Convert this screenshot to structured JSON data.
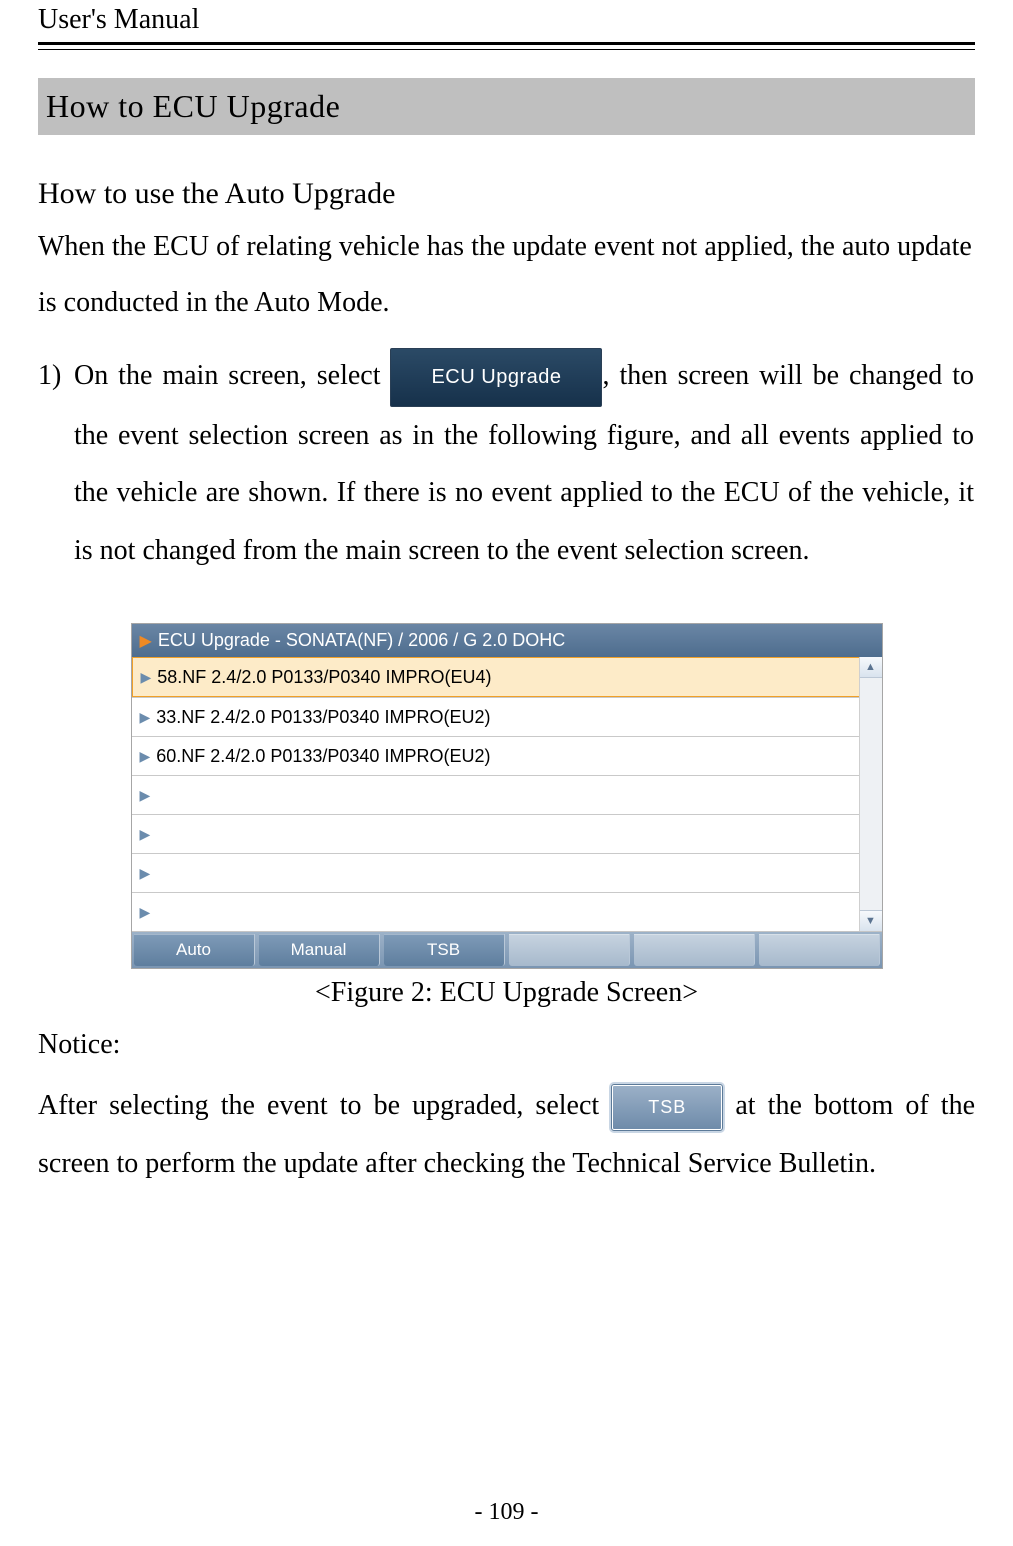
{
  "header": {
    "manual_title": "User's Manual"
  },
  "section": {
    "title": "How to ECU Upgrade",
    "subtitle": "How to use the Auto Upgrade",
    "intro": "When the ECU of relating vehicle has the update event not applied, the auto update is conducted in the Auto Mode.",
    "step_num": "1)",
    "step_a": "On the main screen, select ",
    "ecu_btn_label": "ECU Upgrade",
    "step_b": ", then screen will be changed to the event selection screen as in the following figure, and all events applied to the vehicle are shown. If there is no event applied to the ECU of the vehicle, it is not changed from the main screen to the event selection screen."
  },
  "screenshot": {
    "title_prefix": "▶",
    "title": "ECU Upgrade - SONATA(NF) / 2006 / G 2.0 DOHC",
    "rows": [
      {
        "label": "58.NF 2.4/2.0 P0133/P0340 IMPRO(EU4)",
        "selected": true
      },
      {
        "label": "33.NF 2.4/2.0 P0133/P0340 IMPRO(EU2)",
        "selected": false
      },
      {
        "label": "60.NF 2.4/2.0 P0133/P0340 IMPRO(EU2)",
        "selected": false
      },
      {
        "label": "",
        "selected": false
      },
      {
        "label": "",
        "selected": false
      },
      {
        "label": "",
        "selected": false
      },
      {
        "label": "",
        "selected": false
      }
    ],
    "tabs": [
      "Auto",
      "Manual",
      "TSB"
    ],
    "caption": "<Figure 2: ECU Upgrade Screen>"
  },
  "notice": {
    "label": "Notice:",
    "text_a": "After selecting the event to be upgraded, select ",
    "tsb_btn_label": "TSB",
    "text_b": " at the bottom of the screen to perform the update after checking the Technical Service Bulletin."
  },
  "footer": {
    "page_number": "- 109 -"
  }
}
